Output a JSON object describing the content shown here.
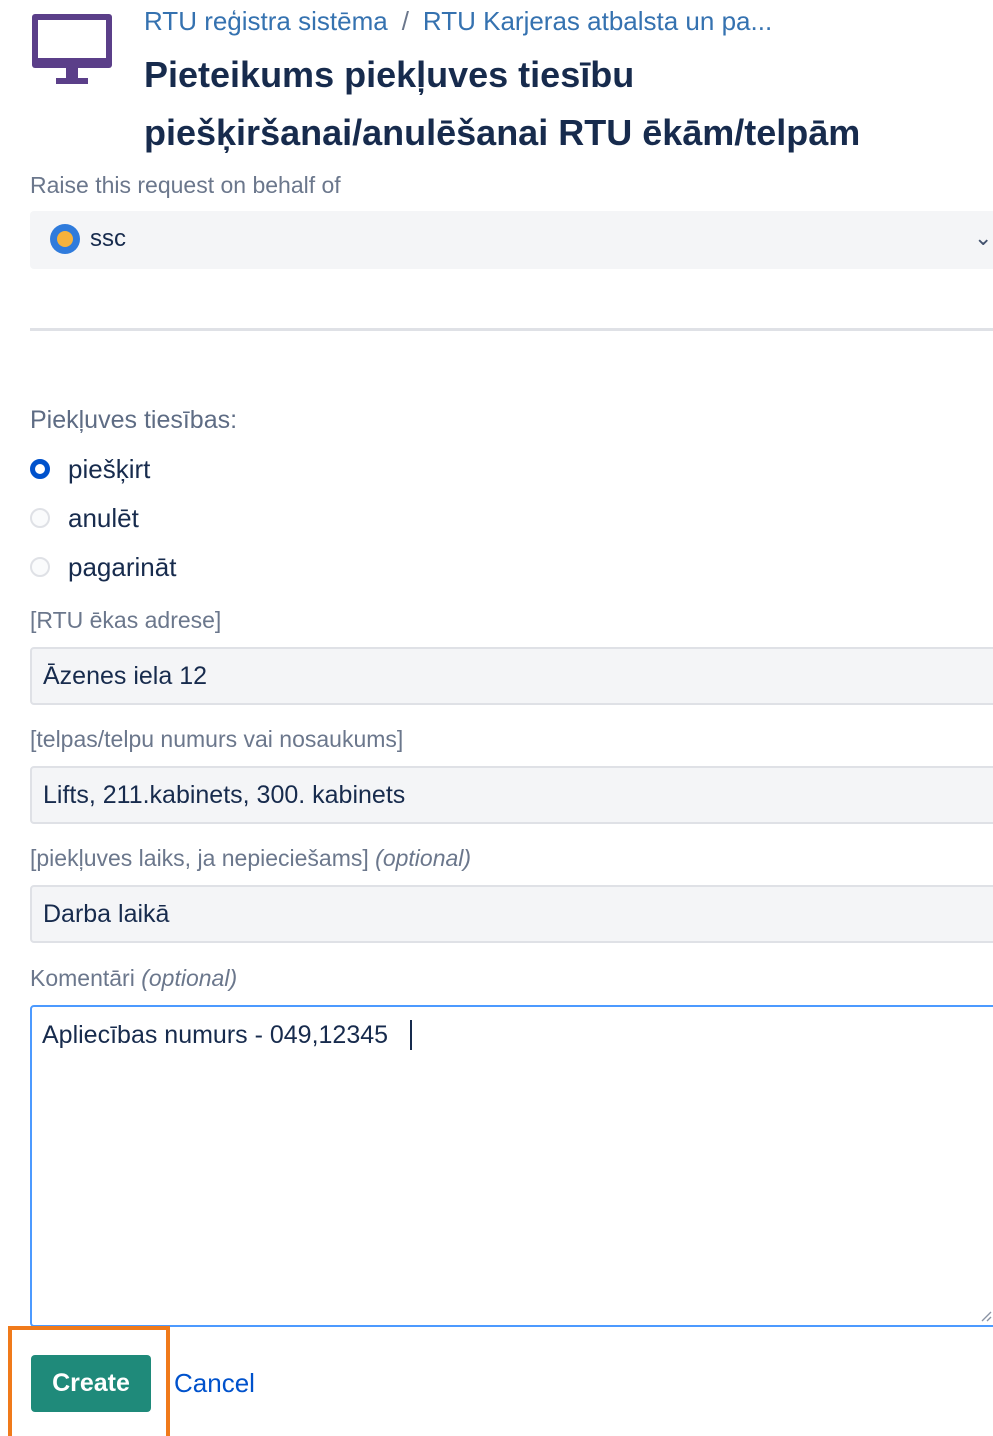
{
  "header": {
    "breadcrumb": [
      {
        "label": "RTU reģistra sistēma"
      },
      {
        "label": "RTU Karjeras atbalsta un pa..."
      }
    ],
    "breadcrumb_separator": "/",
    "title": "Pieteikums piekļuves tiesību piešķiršanai/anulēšanai RTU ēkām/telpām",
    "icon": "monitor-icon",
    "icon_color": "#5b3f89"
  },
  "behalf": {
    "label": "Raise this request on behalf of",
    "value": "ssc",
    "avatar_icon": "avatar-icon"
  },
  "access_rights": {
    "label": "Piekļuves tiesības:",
    "options": [
      {
        "label": "piešķirt",
        "checked": true
      },
      {
        "label": "anulēt",
        "checked": false
      },
      {
        "label": "pagarināt",
        "checked": false
      }
    ]
  },
  "fields": {
    "address": {
      "label": "[RTU ēkas adrese]",
      "value": "Āzenes iela 12"
    },
    "room": {
      "label": "[telpas/telpu numurs vai nosaukums]",
      "value": "Lifts, 211.kabinets, 300. kabinets"
    },
    "time": {
      "label": "[piekļuves laiks, ja nepieciešams]",
      "optional": "(optional)",
      "value": "Darba laikā"
    },
    "comments": {
      "label": "Komentāri",
      "optional": "(optional)",
      "value": "Apliecības numurs - 049,12345"
    }
  },
  "actions": {
    "create_label": "Create",
    "cancel_label": "Cancel",
    "primary_color": "#1f8a7a",
    "highlight_color": "#f07a1a"
  }
}
